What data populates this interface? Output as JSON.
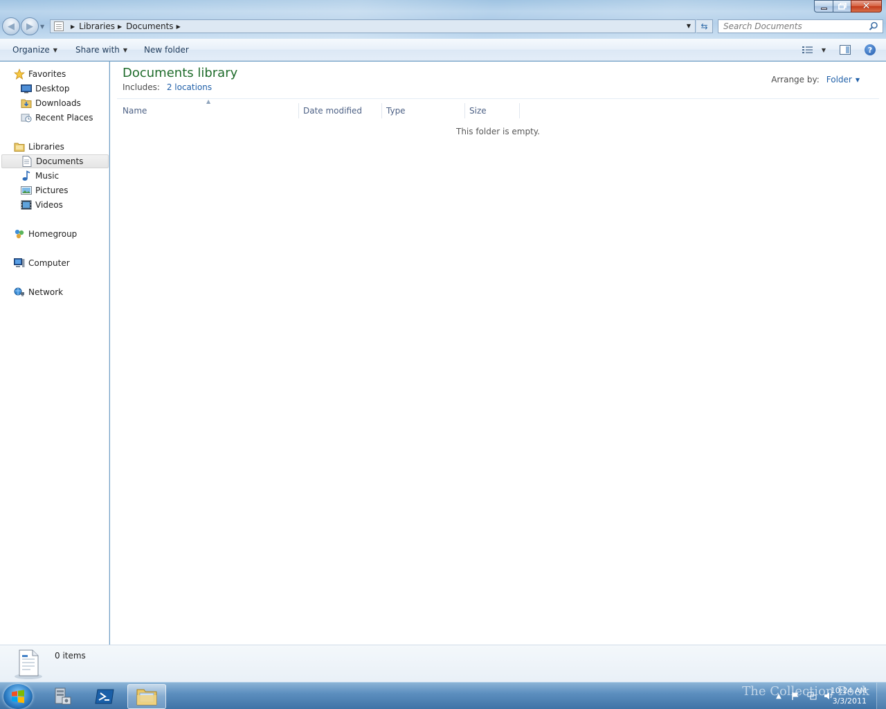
{
  "address": {
    "crumbs": [
      "Libraries",
      "Documents"
    ]
  },
  "search": {
    "placeholder": "Search Documents"
  },
  "toolbar": {
    "organize": "Organize",
    "share_with": "Share with",
    "new_folder": "New folder",
    "icons": [
      "change-view-icon",
      "preview-pane-icon",
      "help-icon"
    ]
  },
  "sidebar": {
    "favorites": {
      "label": "Favorites",
      "items": [
        "Desktop",
        "Downloads",
        "Recent Places"
      ]
    },
    "libraries": {
      "label": "Libraries",
      "items": [
        "Documents",
        "Music",
        "Pictures",
        "Videos"
      ],
      "selected": "Documents"
    },
    "homegroup": "Homegroup",
    "computer": "Computer",
    "network": "Network"
  },
  "content": {
    "title": "Documents library",
    "includes_label": "Includes:",
    "includes_link": "2 locations",
    "arrange_label": "Arrange by:",
    "arrange_value": "Folder",
    "columns": [
      "Name",
      "Date modified",
      "Type",
      "Size"
    ],
    "empty_message": "This folder is empty."
  },
  "details": {
    "count": "0 items"
  },
  "taskbar": {
    "clock_time": "10:24 AM",
    "clock_date": "3/3/2011",
    "watermark": "The Collection Book"
  },
  "colors": {
    "title_green": "#1e6b2a",
    "link_blue": "#1f5fa8",
    "selected_bg": "#e5e5e5"
  }
}
